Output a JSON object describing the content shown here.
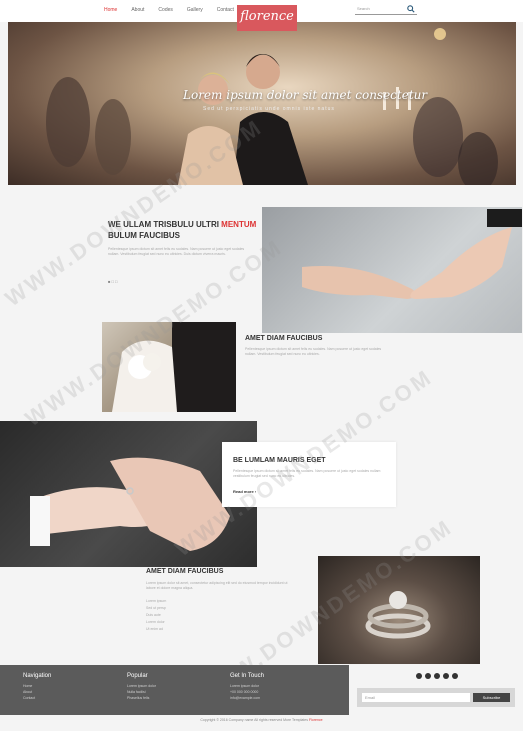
{
  "header": {
    "nav": [
      "Home",
      "About",
      "Codes",
      "Gallery",
      "Contact"
    ],
    "logo": "florence",
    "search_placeholder": "Search"
  },
  "hero": {
    "caption": "Lorem ipsum dolor sit amet consectetur",
    "sub": "Sed ut perspiciatis unde omnis iste natus"
  },
  "sections": [
    {
      "title_before": "WE ULLAM TRISBULU ULTRI ",
      "title_accent": "MENTUM",
      "title_after": " BULUM FAUCIBUS",
      "text": "Pellentesque ipsum dictum sit amet felis eu sodales. Nam posuere ut justo eget sodales nullam. Vestibulum feugiat sed nunc eu ultricies. Duis dictum viverra mauris.",
      "dots": "■ □ □"
    },
    {
      "title": "AMET DIAM FAUCIBUS",
      "text": "Pellentesque ipsum dictum sit amet felis eu sodales. Nam posuere ut justo eget sodales nullam. Vestibulum feugiat sed nunc eu ultricies."
    },
    {
      "title": "BE LUMLAM MAURIS EGET",
      "text": "Pellentesque ipsum dictum sit amet felis eu sodales. Nam posuere ut justo eget sodales nullam vestibulum feugiat sed nunc eu ultricies.",
      "more": "Read more"
    },
    {
      "title": "AMET DIAM FAUCIBUS",
      "text": "Lorem ipsum dolor sit amet, consectetur adipiscing elit sed do eiusmod tempor incididunt ut labore et dolore magna aliqua.",
      "list": [
        "Lorem ipsum",
        "Sed ut persp",
        "Duis aute",
        "Lorem dolor",
        "Ut enim ad"
      ]
    }
  ],
  "footer": {
    "navigation": {
      "heading": "Navigation",
      "links": [
        "Home",
        "About",
        "Contact"
      ]
    },
    "popular": {
      "heading": "Popular",
      "links": [
        "Lorem ipsum dolor",
        "Nulla facilisi",
        "Phasellus felis"
      ]
    },
    "touch": {
      "heading": "Get In Touch",
      "links": [
        "Lorem ipsum dolor",
        "+00 000 000 0000",
        "info@example.com"
      ]
    },
    "email_placeholder": "Email",
    "subscribe": "Subscribe",
    "copyright": "Copyright © 2016 Company name All rights reserved More Templates",
    "copyright_accent": "Florence"
  },
  "colors": {
    "accent": "#d33333",
    "logo_bg": "#d9585d",
    "footer_bg": "#5b5b5b"
  }
}
